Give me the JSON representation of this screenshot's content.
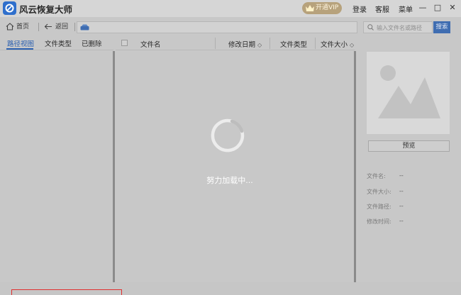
{
  "app": {
    "title": "风云恢复大师",
    "vip_label": "开通VIP",
    "login_label": "登录",
    "service_label": "客服",
    "menu_label": "菜单",
    "minimize_glyph": "—",
    "maximize_glyph": "□",
    "close_glyph": "✕"
  },
  "toolbar": {
    "home_label": "首页",
    "back_label": "返回",
    "search_placeholder": "输入文件名或路径",
    "search_button": "搜索"
  },
  "left_tabs": [
    {
      "label": "路径视图",
      "active": true
    },
    {
      "label": "文件类型",
      "active": false
    },
    {
      "label": "已删除",
      "active": false
    }
  ],
  "file_table": {
    "columns": [
      "文件名",
      "修改日期",
      "文件类型",
      "文件大小"
    ]
  },
  "loading": {
    "text": "努力加载中..."
  },
  "preview": {
    "button_label": "预览",
    "fields": [
      {
        "label": "文件名:",
        "value": "--"
      },
      {
        "label": "文件大小:",
        "value": "--"
      },
      {
        "label": "文件路径:",
        "value": "--"
      },
      {
        "label": "修改时间:",
        "value": "--"
      }
    ]
  },
  "colors": {
    "accent": "#2a5fb0",
    "overlay_bg": "#c8c8c8",
    "vip_gold": "#b7a27c",
    "highlight_red": "#e03030"
  }
}
